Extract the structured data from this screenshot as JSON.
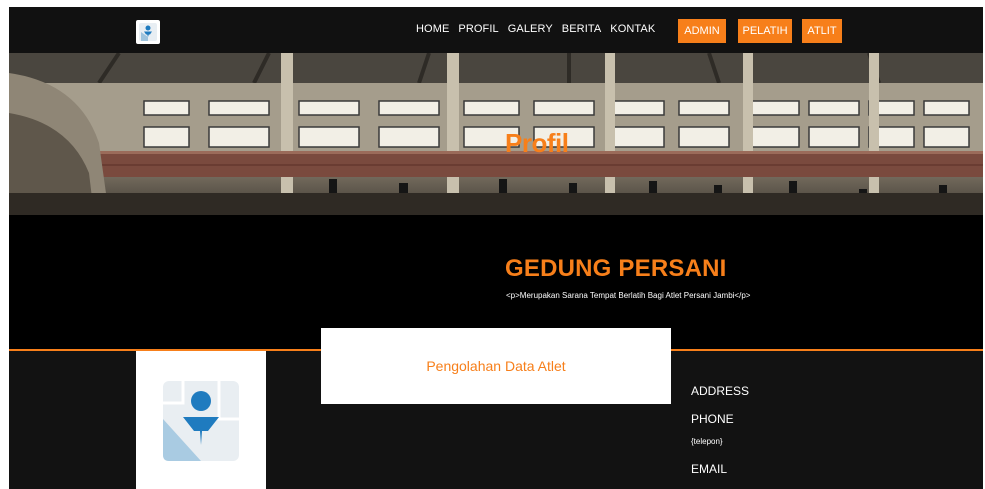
{
  "nav": {
    "links": [
      "HOME",
      "PROFIL",
      "GALERY",
      "BERITA",
      "KONTAK"
    ],
    "admin": "ADMIN",
    "pelatih": "PELATIH",
    "atlit": "ATLIT"
  },
  "hero": {
    "title": "Profil"
  },
  "intro": {
    "title": "GEDUNG PERSANI",
    "description": "<p>Merupakan Sarana Tempat Berlatih Bagi Atlet Persani Jambi</p>"
  },
  "panel": {
    "title": "Pengolahan Data Atlet"
  },
  "contact": {
    "address_label": "ADDRESS",
    "phone_label": "PHONE",
    "phone_value": "{telepon}",
    "email_label": "EMAIL"
  },
  "colors": {
    "accent": "#f77f1a",
    "navbar": "#111111",
    "footer": "#121212"
  },
  "icons": {
    "logo": "map-person-icon",
    "avatar": "map-person-icon"
  }
}
